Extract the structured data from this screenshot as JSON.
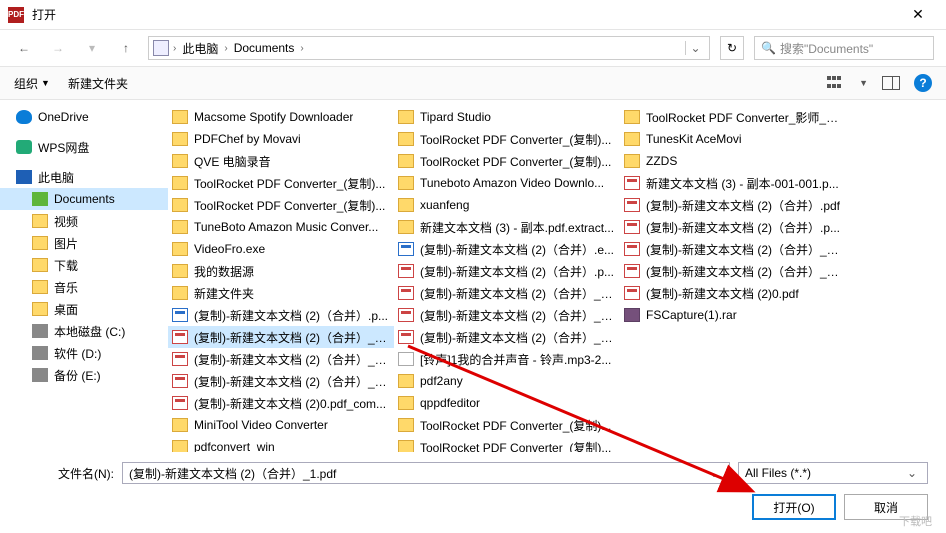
{
  "title": "打开",
  "breadcrumb": {
    "pc": "此电脑",
    "docs": "Documents"
  },
  "search_placeholder": "搜索\"Documents\"",
  "toolbar": {
    "organize": "组织",
    "newfolder": "新建文件夹"
  },
  "sidebar": [
    {
      "label": "OneDrive",
      "icon": "si-cloud",
      "indent": 0
    },
    {
      "label": "WPS网盘",
      "icon": "si-wps",
      "indent": 0
    },
    {
      "label": "此电脑",
      "icon": "si-pc",
      "indent": 0
    },
    {
      "label": "Documents",
      "icon": "si-doc",
      "indent": 1,
      "selected": true
    },
    {
      "label": "视频",
      "icon": "si-folder",
      "indent": 1
    },
    {
      "label": "图片",
      "icon": "si-folder",
      "indent": 1
    },
    {
      "label": "下载",
      "icon": "si-folder",
      "indent": 1
    },
    {
      "label": "音乐",
      "icon": "si-folder",
      "indent": 1
    },
    {
      "label": "桌面",
      "icon": "si-folder",
      "indent": 1
    },
    {
      "label": "本地磁盘 (C:)",
      "icon": "si-drive",
      "indent": 1
    },
    {
      "label": "软件 (D:)",
      "icon": "si-drive",
      "indent": 1
    },
    {
      "label": "备份 (E:)",
      "icon": "si-drive",
      "indent": 1
    }
  ],
  "files": [
    {
      "name": "Macsome Spotify Downloader",
      "type": "folder"
    },
    {
      "name": "PDFChef by Movavi",
      "type": "folder"
    },
    {
      "name": "QVE 电脑录音",
      "type": "folder"
    },
    {
      "name": "ToolRocket PDF Converter_(复制)...",
      "type": "folder"
    },
    {
      "name": "ToolRocket PDF Converter_(复制)...",
      "type": "folder"
    },
    {
      "name": "TuneBoto Amazon Music Conver...",
      "type": "folder"
    },
    {
      "name": "VideoFro.exe",
      "type": "folder"
    },
    {
      "name": "我的数据源",
      "type": "folder"
    },
    {
      "name": "新建文件夹",
      "type": "folder"
    },
    {
      "name": "(复制)-新建文本文档 (2)（合并）.p...",
      "type": "doc"
    },
    {
      "name": "(复制)-新建文本文档 (2)（合并）_1...",
      "type": "pdf",
      "selected": true
    },
    {
      "name": "(复制)-新建文本文档 (2)（合并）_加...",
      "type": "pdf"
    },
    {
      "name": "(复制)-新建文本文档 (2)（合并）_已...",
      "type": "pdf"
    },
    {
      "name": "(复制)-新建文本文档 (2)0.pdf_com...",
      "type": "pdf"
    },
    {
      "name": "MiniTool Video Converter",
      "type": "folder"
    },
    {
      "name": "pdfconvert_win",
      "type": "folder"
    },
    {
      "name": "Tipard Studio",
      "type": "folder"
    },
    {
      "name": "ToolRocket PDF Converter_(复制)...",
      "type": "folder"
    },
    {
      "name": "ToolRocket PDF Converter_(复制)...",
      "type": "folder"
    },
    {
      "name": "Tuneboto Amazon Video Downlo...",
      "type": "folder"
    },
    {
      "name": "xuanfeng",
      "type": "folder"
    },
    {
      "name": "新建文本文档 (3) - 副本.pdf.extract...",
      "type": "folder"
    },
    {
      "name": "(复制)-新建文本文档 (2)（合并）.e...",
      "type": "doc"
    },
    {
      "name": "(复制)-新建文本文档 (2)（合并）.p...",
      "type": "pdf"
    },
    {
      "name": "(复制)-新建文本文档 (2)（合并）_c...",
      "type": "pdf"
    },
    {
      "name": "(复制)-新建文本文档 (2)（合并）_加...",
      "type": "pdf"
    },
    {
      "name": "(复制)-新建文本文档 (2)（合并）_加...",
      "type": "pdf"
    },
    {
      "name": "[铃声]1我的合并声音 - 铃声.mp3-2...",
      "type": "file"
    },
    {
      "name": "pdf2any",
      "type": "folder"
    },
    {
      "name": "qppdfeditor",
      "type": "folder"
    },
    {
      "name": "ToolRocket PDF Converter_(复制)...",
      "type": "folder"
    },
    {
      "name": "ToolRocket PDF Converter_(复制)...",
      "type": "folder"
    },
    {
      "name": "ToolRocket PDF Converter_影师_s...",
      "type": "folder"
    },
    {
      "name": "TunesKit AceMovi",
      "type": "folder"
    },
    {
      "name": "ZZDS",
      "type": "folder"
    },
    {
      "name": "新建文本文档 (3) - 副本-001-001.p...",
      "type": "pdf"
    },
    {
      "name": "(复制)-新建文本文档 (2)（合并）.pdf",
      "type": "pdf"
    },
    {
      "name": "(复制)-新建文本文档 (2)（合并）.p...",
      "type": "pdf"
    },
    {
      "name": "(复制)-新建文本文档 (2)（合并）_c...",
      "type": "pdf"
    },
    {
      "name": "(复制)-新建文本文档 (2)（合并）_加...",
      "type": "pdf"
    },
    {
      "name": "(复制)-新建文本文档 (2)0.pdf",
      "type": "pdf"
    },
    {
      "name": "FSCapture(1).rar",
      "type": "rar"
    }
  ],
  "filename_label": "文件名(N):",
  "filename_value": "(复制)-新建文本文档 (2)（合并）_1.pdf",
  "filter": "All Files (*.*)",
  "open_btn": "打开(O)",
  "cancel_btn": "取消",
  "help_label": "下载吧"
}
